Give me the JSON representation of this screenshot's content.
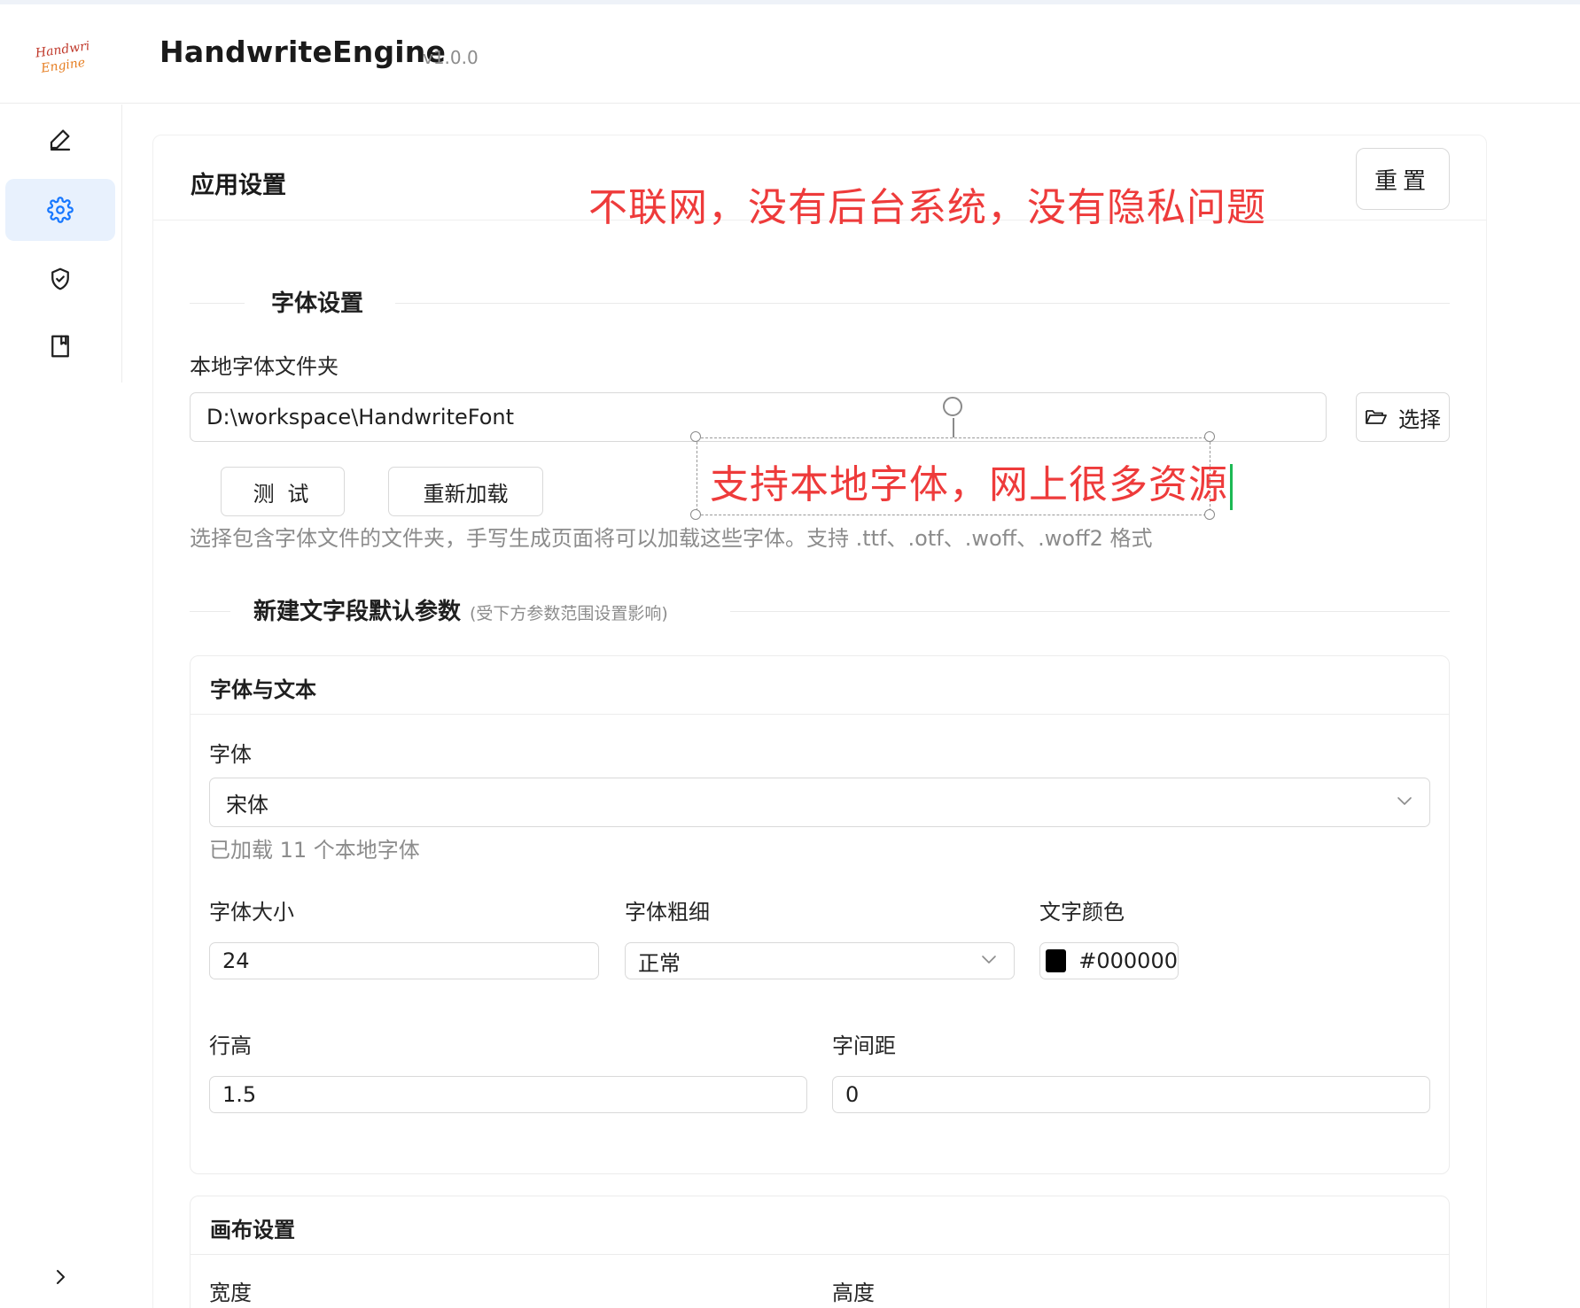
{
  "app": {
    "title": "HandwriteEngine",
    "version": "v1.0.0",
    "logo_text_line1": "Handwrite",
    "logo_text_line2": "Engine"
  },
  "sidebar": {
    "items": [
      {
        "name": "edit",
        "icon": "pencil-icon",
        "active": false
      },
      {
        "name": "settings",
        "icon": "gear-icon",
        "active": true
      },
      {
        "name": "security",
        "icon": "shield-check-icon",
        "active": false
      },
      {
        "name": "docs",
        "icon": "book-icon",
        "active": false
      }
    ],
    "expand_icon": "chevron-right-icon"
  },
  "page": {
    "title": "应用设置",
    "reset_label": "重置"
  },
  "annotations": {
    "top": "不联网，没有后台系统，没有隐私问题",
    "box": "支持本地字体，网上很多资源"
  },
  "font_settings": {
    "section_title": "字体设置",
    "folder_label": "本地字体文件夹",
    "folder_value": "D:\\workspace\\HandwriteFont",
    "choose_label": "选择",
    "test_label": "测 试",
    "reload_label": "重新加载",
    "helper": "选择包含字体文件的文件夹，手写生成页面将可以加载这些字体。支持 .ttf、.otf、.woff、.woff2 格式"
  },
  "new_segment": {
    "section_title": "新建文字段默认参数",
    "section_hint": "(受下方参数范围设置影响)"
  },
  "font_text_panel": {
    "title": "字体与文本",
    "font_label": "字体",
    "font_value": "宋体",
    "font_helper": "已加载 11 个本地字体",
    "size_label": "字体大小",
    "size_value": "24",
    "weight_label": "字体粗细",
    "weight_value": "正常",
    "color_label": "文字颜色",
    "color_value": "#000000",
    "line_height_label": "行高",
    "line_height_value": "1.5",
    "spacing_label": "字间距",
    "spacing_value": "0"
  },
  "canvas_panel": {
    "title": "画布设置",
    "width_label": "宽度",
    "height_label": "高度"
  },
  "colors": {
    "accent": "#1677ff",
    "active_bg": "#e8f1fd",
    "annotation_red": "#ee3b3b",
    "caret_green": "#1db954",
    "text_color_swatch": "#000000"
  }
}
